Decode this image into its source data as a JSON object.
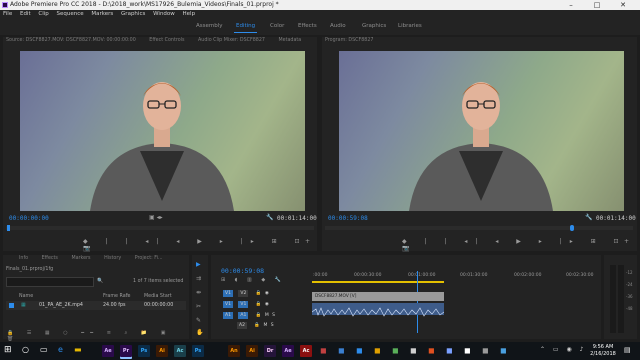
{
  "window": {
    "title": "Adobe Premiere Pro CC 2018 - D:\\2018_work\\MS17926_Bulemia_Videos\\Finals_01.prproj *",
    "controls": [
      "–",
      "□",
      "✕"
    ]
  },
  "menu": [
    "File",
    "Edit",
    "Clip",
    "Sequence",
    "Markers",
    "Graphics",
    "Window",
    "Help"
  ],
  "workspaces": {
    "items": [
      "Assembly",
      "Editing",
      "Color",
      "Effects",
      "Audio",
      "Graphics",
      "Libraries"
    ],
    "active": "Editing"
  },
  "source_monitor": {
    "tabs": [
      "Source: DSCF8827.MOV: DSCF8827.MOV: 00:00:00:00",
      "Effect Controls",
      "Audio Clip Mixer: DSCF8827",
      "Metadata"
    ],
    "timecode_in": "00:00:00:00",
    "timecode_out": "00:01:14:00"
  },
  "program_monitor": {
    "tabs": [
      "Program: DSCF8827"
    ],
    "timecode_in": "00:00:59:08",
    "timecode_out": "00:01:14:00"
  },
  "project_panel": {
    "tabs": [
      "Info",
      "Effects",
      "Markers",
      "History",
      "Project: Fi..."
    ],
    "project_file": "Finals_01.prproj/1fg",
    "selection_info": "1 of 7 items selected",
    "columns": [
      "Name",
      "Frame Rate",
      "Media Start"
    ],
    "rows": [
      {
        "name": "01_PA_AE_2K.mp4",
        "frame_rate": "24.00 fps",
        "media_start": "00:00:00:00"
      }
    ]
  },
  "timeline": {
    "timecode": "00:00:59:08",
    "ruler": [
      ":00:00",
      "00:00:30:00",
      "00:01:00:00",
      "00:01:30:00",
      "00:02:00:00",
      "00:02:30:00"
    ],
    "tracks": [
      "V2",
      "V1",
      "A1",
      "A2",
      "A3"
    ],
    "clip_label": "DSCF8827.MOV [V]"
  },
  "meters": {
    "scale": [
      "-12",
      "-24",
      "-36",
      "-48"
    ]
  },
  "taskbar": {
    "time": "9:56 AM",
    "date": "2/16/2018",
    "apps": [
      {
        "label": "Ae",
        "color": "#2a0a4a"
      },
      {
        "label": "Pr",
        "color": "#2a0a4a"
      },
      {
        "label": "Ps",
        "color": "#0b2b46"
      },
      {
        "label": "Ai",
        "color": "#3a1a05"
      },
      {
        "label": "Ac",
        "color": "#1a3f4a"
      },
      {
        "label": "Ps",
        "color": "#0b2b46"
      },
      {
        "label": "An",
        "color": "#3a1a05"
      },
      {
        "label": "Ai",
        "color": "#3a1a05"
      },
      {
        "label": "Dr",
        "color": "#25143a"
      },
      {
        "label": "Ae",
        "color": "#2a0a4a"
      },
      {
        "label": "Ac",
        "color": "#8a1010"
      }
    ]
  }
}
